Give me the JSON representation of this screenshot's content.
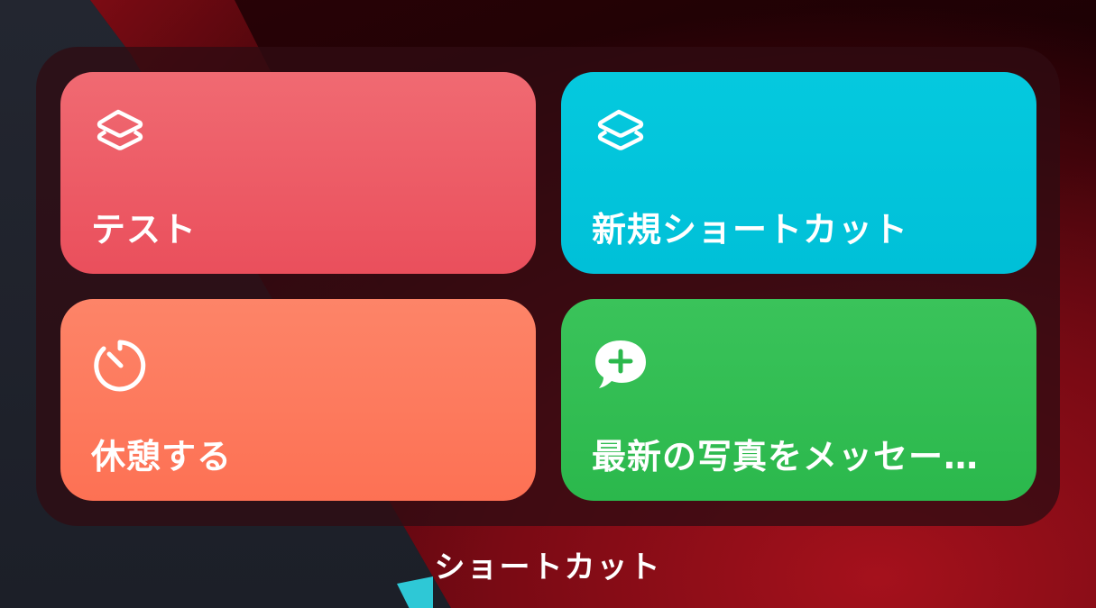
{
  "widget": {
    "title": "ショートカット",
    "tiles": [
      {
        "label": "テスト",
        "icon": "shortcuts-layers-icon",
        "color": "#ee5d68"
      },
      {
        "label": "新規ショートカット",
        "icon": "shortcuts-layers-icon",
        "color": "#03c4db"
      },
      {
        "label": "休憩する",
        "icon": "timer-icon",
        "color": "#fd7a5e"
      },
      {
        "label": "最新の写真をメッセー…",
        "icon": "message-add-icon",
        "color": "#33bd53"
      }
    ]
  }
}
